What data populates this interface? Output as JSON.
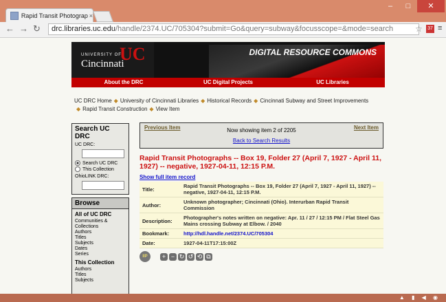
{
  "browser": {
    "tab_title": "Rapid Transit Photograph",
    "tab_close": "×",
    "url_host": "drc.libraries.uc.edu",
    "url_rest": "/handle/2374.UC/705304?submit=Go&query=subway&focusscope=&mode=search",
    "ext_badge": "37",
    "win_min": "‒",
    "win_max": "□",
    "win_close": "✕"
  },
  "banner": {
    "univ_of": "UNIVERSITY OF",
    "univ_name": "Cincinnati",
    "logo": "UC",
    "site_title": "DIGITAL RESOURCE COMMONS",
    "nav": [
      "About the DRC",
      "UC Digital Projects",
      "UC Libraries"
    ]
  },
  "breadcrumb": [
    "UC DRC Home",
    "University of Cincinnati Libraries",
    "Historical Records",
    "Cincinnati Subway and Street Improvements",
    "Rapid Transit Construction",
    "View Item"
  ],
  "sidebar": {
    "search_title": "Search UC DRC",
    "uc_label": "UC DRC:",
    "radio_all": "Search UC DRC",
    "radio_coll": "This Collection",
    "ohiolink_label": "OhioLINK DRC:",
    "browse_title": "Browse",
    "all_heading": "All of UC DRC",
    "all_items": [
      "Communities &",
      "Collections",
      "Authors",
      "Titles",
      "Subjects",
      "Dates",
      "Series"
    ],
    "coll_heading": "This Collection",
    "coll_items": [
      "Authors",
      "Titles",
      "Subjects"
    ]
  },
  "pager": {
    "prev": "Previous Item",
    "next": "Next Item",
    "showing": "Now showing item 2 of 2205",
    "back": "Back to Search Results"
  },
  "item": {
    "title": "Rapid Transit Photographs -- Box 19, Folder 27 (April 7, 1927 - April 11, 1927) -- negative, 1927-04-11, 12:15 P.M.",
    "full_record": "Show full item record",
    "fields": [
      {
        "k": "Title:",
        "v": "Rapid Transit Photographs -- Box 19, Folder 27 (April 7, 1927 - April 11, 1927) -- negative, 1927-04-11, 12:15 P.M."
      },
      {
        "k": "Author:",
        "v": "Unknown photographer; Cincinnati (Ohio). Interurban Rapid Transit Commission"
      },
      {
        "k": "Description:",
        "v": "Photographer's notes written on negative: Apr. 11 / 27 / 12:15 PM / Flat Steel Gas Mains crossing Subway at Elbow. / 2040"
      },
      {
        "k": "Bookmark:",
        "v": "http://hdl.handle.net/2374.UC/705304"
      },
      {
        "k": "Date:",
        "v": "1927-04-11T17:15:00Z"
      }
    ]
  },
  "viewer": {
    "iip": "IIP",
    "buttons": [
      "+",
      "−",
      "↻",
      "↺",
      "⟲",
      "⧉"
    ]
  }
}
